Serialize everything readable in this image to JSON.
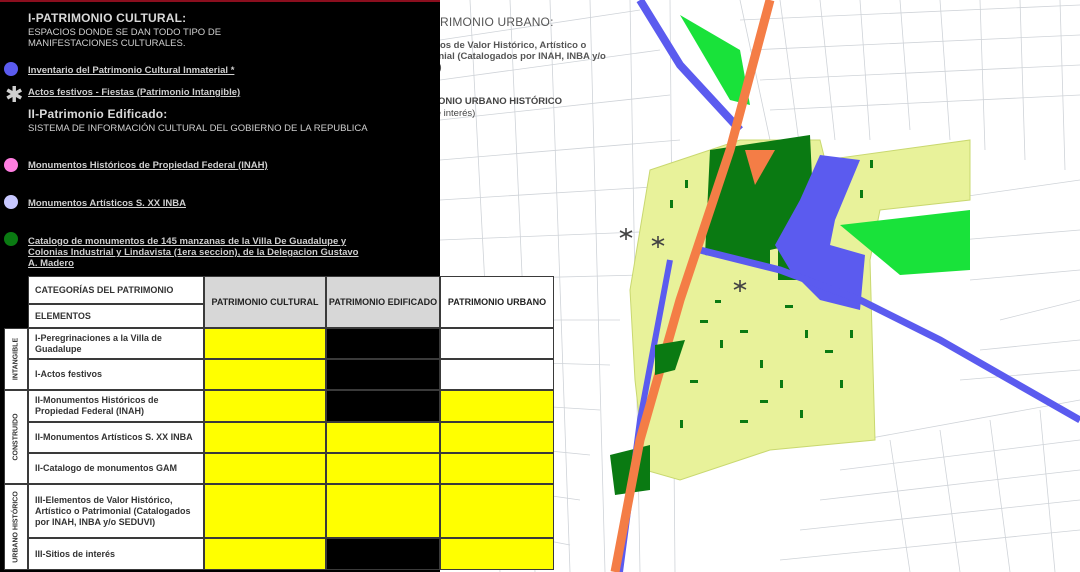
{
  "legend": {
    "cultural_title": "I-PATRIMONIO CULTURAL:",
    "cultural_sub": "ESPACIOS DONDE SE DAN TODO TIPO DE MANIFESTACIONES CULTURALES.",
    "item_inmaterial": "Inventario del Patrimonio Cultural Inmaterial *",
    "item_actos": "Actos festivos - Fiestas (Patrimonio Intangible)",
    "edificado_title": "II-Patrimonio Edificado:",
    "edificado_sub": "SISTEMA DE INFORMACIÓN CULTURAL DEL GOBIERNO DE LA REPUBLICA",
    "item_inah": "Monumentos Históricos de Propiedad Federal (INAH)",
    "item_inba": "Monumentos Artísticos S. XX INBA",
    "item_catalogo": "Catalogo de monumentos de 145 manzanas de la Villa De Guadalupe y Colonias Industrial y Lindavista (1era seccion), de la Delegacion Gustavo A. Madero",
    "urbano_title": "III-PATRIMONIO URBANO:",
    "item_valor": "Elementos de Valor Histórico, Artístico o Patrimonial (Catalogados por INAH, INBA y/o SEDUVI)",
    "item_urbano_hist": "PATRIMONIO URBANO HISTÓRICO",
    "item_sitios": "(sitios de interés)",
    "colors": {
      "blue_dot": "#5b5bef",
      "pink_dot": "#ff7ee0",
      "lavender_dot": "#c8c8ff",
      "green_dot": "#0a7a12",
      "orange_dot": "#f47d46",
      "light_green_dot": "#19e23a"
    }
  },
  "table": {
    "corner_top": "CATEGORÍAS DEL PATRIMONIO",
    "corner_bottom": "ELEMENTOS",
    "headers": [
      "PATRIMONIO CULTURAL",
      "PATRIMONIO EDIFICADO",
      "PATRIMONIO URBANO"
    ],
    "groups": [
      "INTANGIBLE",
      "CONSTRUIDO",
      "URBANO HISTÓRICO"
    ],
    "rows": [
      {
        "label": "I-Peregrinaciones a la Villa de Guadalupe",
        "cells": [
          "yellow",
          "black",
          "white"
        ]
      },
      {
        "label": "I-Actos festivos",
        "cells": [
          "yellow",
          "black",
          "white"
        ]
      },
      {
        "label": "II-Monumentos Históricos de Propiedad Federal (INAH)",
        "cells": [
          "yellow",
          "black",
          "yellow"
        ]
      },
      {
        "label": "II-Monumentos Artísticos S. XX INBA",
        "cells": [
          "yellow",
          "yellow",
          "yellow"
        ]
      },
      {
        "label": "II-Catalogo de monumentos GAM",
        "cells": [
          "yellow",
          "yellow",
          "yellow"
        ]
      },
      {
        "label": "III-Elementos de Valor Histórico, Artístico o Patrimonial (Catalogados por INAH, INBA y/o SEDUVI)",
        "cells": [
          "yellow",
          "yellow",
          "yellow"
        ]
      },
      {
        "label": "III-Sitios de interés",
        "cells": [
          "yellow",
          "black",
          "yellow"
        ]
      }
    ]
  }
}
